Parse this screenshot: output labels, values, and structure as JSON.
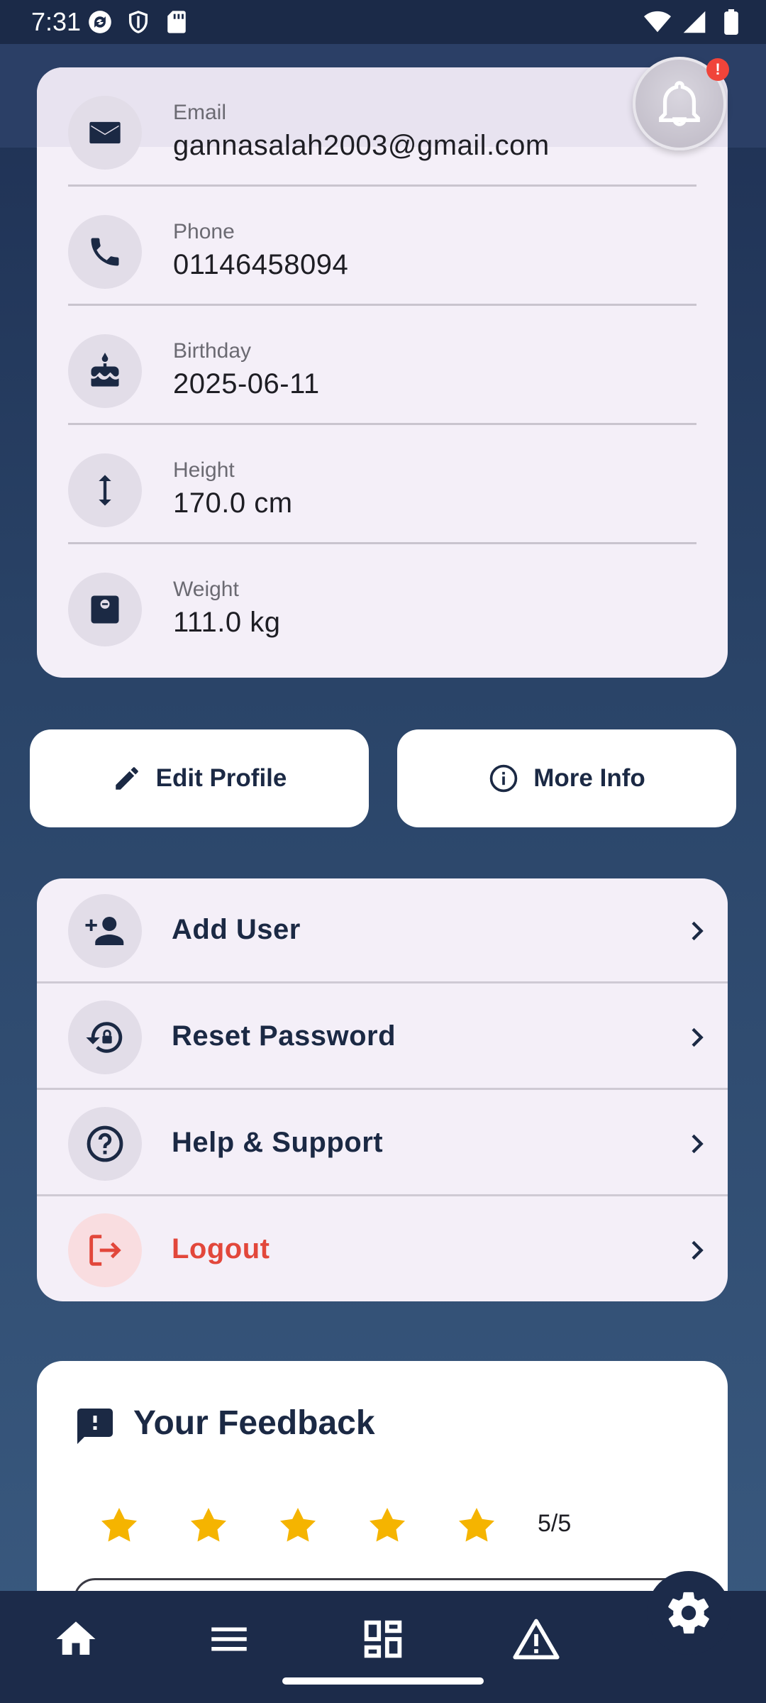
{
  "status_bar": {
    "time": "7:31",
    "left_icons": [
      "sync-icon",
      "shield-icon",
      "sd-card-icon"
    ],
    "right_icons": [
      "wifi-icon",
      "signal-icon",
      "battery-icon"
    ]
  },
  "notification": {
    "badge": "!"
  },
  "profile_info": [
    {
      "label": "Email",
      "value": "gannasalah2003@gmail.com",
      "icon": "email-icon"
    },
    {
      "label": "Phone",
      "value": "01146458094",
      "icon": "phone-icon"
    },
    {
      "label": "Birthday",
      "value": "2025-06-11",
      "icon": "cake-icon"
    },
    {
      "label": "Height",
      "value": "170.0 cm",
      "icon": "height-icon"
    },
    {
      "label": "Weight",
      "value": "111.0 kg",
      "icon": "scale-icon"
    }
  ],
  "actions": {
    "edit_profile": "Edit Profile",
    "more_info": "More Info"
  },
  "menu": [
    {
      "label": "Add User",
      "icon": "add-user-icon"
    },
    {
      "label": "Reset Password",
      "icon": "lock-reset-icon"
    },
    {
      "label": "Help & Support",
      "icon": "help-icon"
    },
    {
      "label": "Logout",
      "icon": "logout-icon",
      "danger": true
    }
  ],
  "feedback": {
    "title": "Your Feedback",
    "stars_filled": 5,
    "stars_total": 5,
    "rating_text": "5/5"
  },
  "colors": {
    "primary": "#1b2944",
    "star": "#f5b400",
    "danger": "#e2473b",
    "card": "#f4eff8"
  },
  "bottom_nav": [
    "home-icon",
    "menu-icon",
    "dashboard-icon",
    "warning-icon"
  ],
  "fab_icon": "settings-icon"
}
